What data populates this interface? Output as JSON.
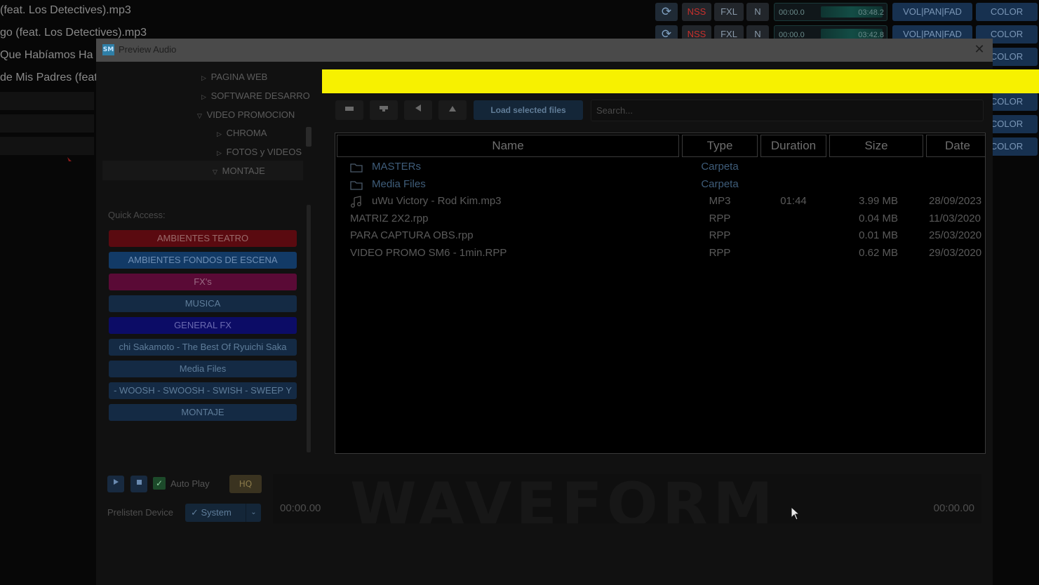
{
  "background_tracks": [
    {
      "name": "(feat. Los Detectives).mp3",
      "time_start": "00:00.0",
      "time_end": "03:48.2",
      "btn_nss": "NSS",
      "btn_fxl": "FXL",
      "btn_n": "N",
      "btn_volpanfad": "VOL|PAN|FAD",
      "btn_color": "COLOR"
    },
    {
      "name": "go (feat. Los Detectives).mp3",
      "time_start": "00:00.0",
      "time_end": "03:42.8",
      "btn_nss": "NSS",
      "btn_fxl": "FXL",
      "btn_n": "N",
      "btn_volpanfad": "VOL|PAN|FAD",
      "btn_color": "COLOR"
    },
    {
      "name": "Que Habíamos Ha",
      "btn_color": "COLOR"
    },
    {
      "name": "de Mis Padres (feat",
      "btn_color": ""
    },
    {
      "name": "",
      "btn_color": "COLOR"
    },
    {
      "name": "",
      "btn_color": "COLOR"
    },
    {
      "name": "",
      "btn_color": "COLOR"
    }
  ],
  "dialog": {
    "title": "Preview Audio",
    "close_glyph": "✕",
    "icon_text": "SM"
  },
  "tree": [
    {
      "label": "PAGINA WEB",
      "arrow": "▷"
    },
    {
      "label": "SOFTWARE DESARRO",
      "arrow": "▷"
    },
    {
      "label": "VIDEO PROMOCION",
      "arrow": "▽"
    },
    {
      "label": "CHROMA",
      "arrow": "▷"
    },
    {
      "label": "FOTOS y VIDEOS",
      "arrow": "▷"
    },
    {
      "label": "MONTAJE",
      "arrow": "▽"
    }
  ],
  "quick_access": {
    "label": "Quick Access:",
    "items": [
      {
        "label": "AMBIENTES TEATRO",
        "bg": "#5a0a10",
        "fg": "#9a6a6a"
      },
      {
        "label": "AMBIENTES FONDOS DE ESCENA",
        "bg": "#123a66",
        "fg": "#6f8fb5"
      },
      {
        "label": "FX's",
        "bg": "#5a0a36",
        "fg": "#9a6a84"
      },
      {
        "label": "MUSICA",
        "bg": "#142a44",
        "fg": "#5f7d9a"
      },
      {
        "label": "GENERAL FX",
        "bg": "#0c0c66",
        "fg": "#6a6ab0"
      },
      {
        "label": "chi Sakamoto - The Best Of Ryuichi Saka",
        "bg": "#142a44",
        "fg": "#5f7d9a"
      },
      {
        "label": "Media Files",
        "bg": "#142a44",
        "fg": "#5f7d9a"
      },
      {
        "label": "- WOOSH - SWOOSH - SWISH - SWEEP Y",
        "bg": "#142a44",
        "fg": "#5f7d9a"
      },
      {
        "label": "MONTAJE",
        "bg": "#142a44",
        "fg": "#5f7d9a"
      }
    ]
  },
  "toolbar": {
    "load_label": "Load selected files",
    "search_placeholder": "Search..."
  },
  "table": {
    "headers": {
      "name": "Name",
      "type": "Type",
      "duration": "Duration",
      "size": "Size",
      "date": "Date"
    },
    "rows": [
      {
        "icon": "folder-icon",
        "name": "MASTERs",
        "type": "Carpeta",
        "duration": "",
        "size": "",
        "date": "",
        "folder": true
      },
      {
        "icon": "folder-icon",
        "name": "Media Files",
        "type": "Carpeta",
        "duration": "",
        "size": "",
        "date": "",
        "folder": true
      },
      {
        "icon": "music-note-icon",
        "name": "uWu Victory - Rod Kim.mp3",
        "type": "MP3",
        "duration": "01:44",
        "size": "3.99 MB",
        "date": "28/09/2023"
      },
      {
        "icon": "",
        "name": "MATRIZ 2X2.rpp",
        "type": "RPP",
        "duration": "",
        "size": "0.04 MB",
        "date": "11/03/2020"
      },
      {
        "icon": "",
        "name": "PARA CAPTURA OBS.rpp",
        "type": "RPP",
        "duration": "",
        "size": "0.01 MB",
        "date": "25/03/2020"
      },
      {
        "icon": "",
        "name": "VIDEO PROMO SM6 - 1min.RPP",
        "type": "RPP",
        "duration": "",
        "size": "0.62 MB",
        "date": "29/03/2020"
      }
    ]
  },
  "player": {
    "autoplay_label": "Auto Play",
    "hq_label": "HQ",
    "prelisten_label": "Prelisten Device",
    "device_value": "✓ System",
    "waveform_watermark": "WAVEFORM",
    "time_start": "00:00.00",
    "time_end": "00:00.00"
  },
  "colors": {
    "yellow_bar": "#f7f100",
    "accent_blue": "#142638"
  }
}
